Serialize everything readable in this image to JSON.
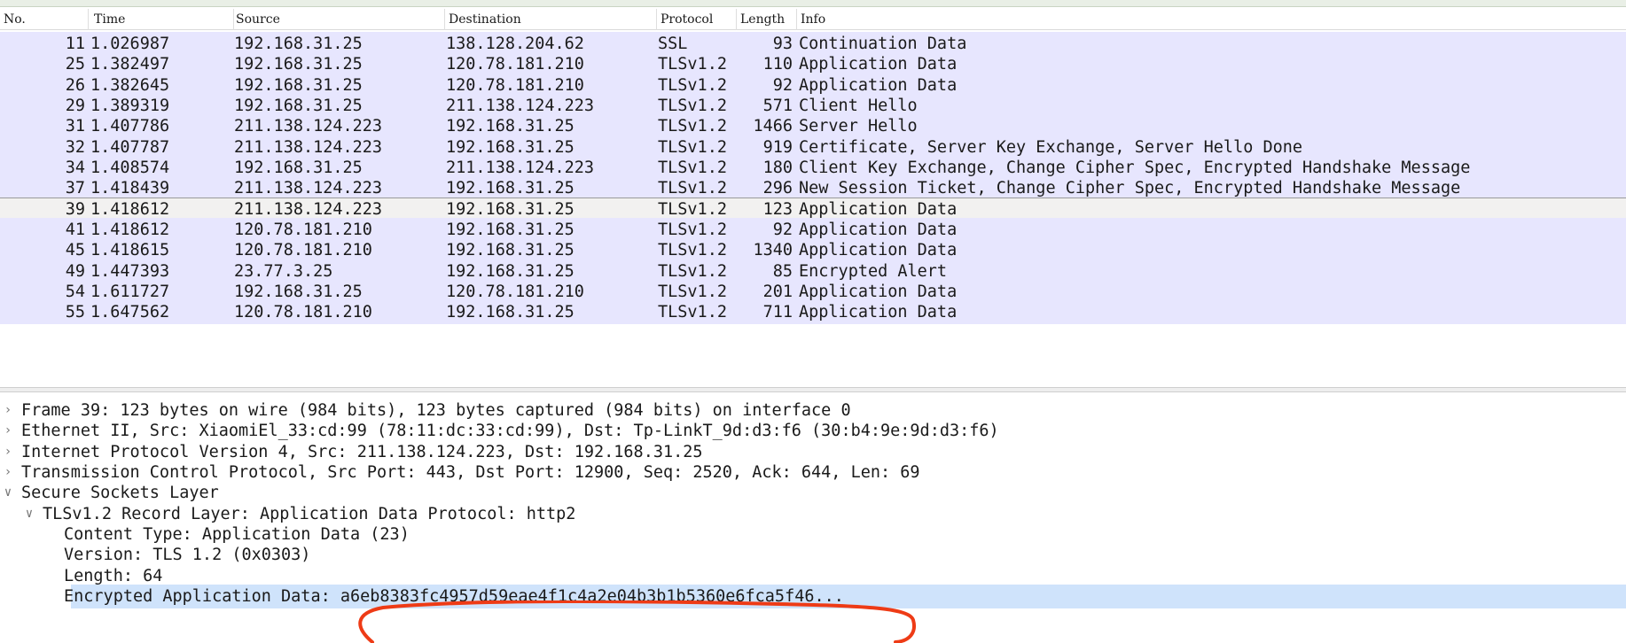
{
  "columns": {
    "no": "No.",
    "time": "Time",
    "source": "Source",
    "destination": "Destination",
    "protocol": "Protocol",
    "length": "Length",
    "info": "Info"
  },
  "packets": [
    {
      "no": "11",
      "time": "1.026987",
      "source": "192.168.31.25",
      "destination": "138.128.204.62",
      "protocol": "SSL",
      "length": "93",
      "info": "Continuation Data"
    },
    {
      "no": "25",
      "time": "1.382497",
      "source": "192.168.31.25",
      "destination": "120.78.181.210",
      "protocol": "TLSv1.2",
      "length": "110",
      "info": "Application Data"
    },
    {
      "no": "26",
      "time": "1.382645",
      "source": "192.168.31.25",
      "destination": "120.78.181.210",
      "protocol": "TLSv1.2",
      "length": "92",
      "info": "Application Data"
    },
    {
      "no": "29",
      "time": "1.389319",
      "source": "192.168.31.25",
      "destination": "211.138.124.223",
      "protocol": "TLSv1.2",
      "length": "571",
      "info": "Client Hello"
    },
    {
      "no": "31",
      "time": "1.407786",
      "source": "211.138.124.223",
      "destination": "192.168.31.25",
      "protocol": "TLSv1.2",
      "length": "1466",
      "info": "Server Hello"
    },
    {
      "no": "32",
      "time": "1.407787",
      "source": "211.138.124.223",
      "destination": "192.168.31.25",
      "protocol": "TLSv1.2",
      "length": "919",
      "info": "Certificate, Server Key Exchange, Server Hello Done"
    },
    {
      "no": "34",
      "time": "1.408574",
      "source": "192.168.31.25",
      "destination": "211.138.124.223",
      "protocol": "TLSv1.2",
      "length": "180",
      "info": "Client Key Exchange, Change Cipher Spec, Encrypted Handshake Message"
    },
    {
      "no": "37",
      "time": "1.418439",
      "source": "211.138.124.223",
      "destination": "192.168.31.25",
      "protocol": "TLSv1.2",
      "length": "296",
      "info": "New Session Ticket, Change Cipher Spec, Encrypted Handshake Message"
    },
    {
      "no": "39",
      "time": "1.418612",
      "source": "211.138.124.223",
      "destination": "192.168.31.25",
      "protocol": "TLSv1.2",
      "length": "123",
      "info": "Application Data",
      "selected": true
    },
    {
      "no": "41",
      "time": "1.418612",
      "source": "120.78.181.210",
      "destination": "192.168.31.25",
      "protocol": "TLSv1.2",
      "length": "92",
      "info": "Application Data"
    },
    {
      "no": "45",
      "time": "1.418615",
      "source": "120.78.181.210",
      "destination": "192.168.31.25",
      "protocol": "TLSv1.2",
      "length": "1340",
      "info": "Application Data"
    },
    {
      "no": "49",
      "time": "1.447393",
      "source": "23.77.3.25",
      "destination": "192.168.31.25",
      "protocol": "TLSv1.2",
      "length": "85",
      "info": "Encrypted Alert"
    },
    {
      "no": "54",
      "time": "1.611727",
      "source": "192.168.31.25",
      "destination": "120.78.181.210",
      "protocol": "TLSv1.2",
      "length": "201",
      "info": "Application Data"
    },
    {
      "no": "55",
      "time": "1.647562",
      "source": "120.78.181.210",
      "destination": "192.168.31.25",
      "protocol": "TLSv1.2",
      "length": "711",
      "info": "Application Data"
    }
  ],
  "details": [
    {
      "text": "Frame 39: 123 bytes on wire (984 bits), 123 bytes captured (984 bits) on interface 0",
      "level": 0,
      "arrow": "collapsed"
    },
    {
      "text": "Ethernet II, Src: XiaomiEl_33:cd:99 (78:11:dc:33:cd:99), Dst: Tp-LinkT_9d:d3:f6 (30:b4:9e:9d:d3:f6)",
      "level": 0,
      "arrow": "collapsed"
    },
    {
      "text": "Internet Protocol Version 4, Src: 211.138.124.223, Dst: 192.168.31.25",
      "level": 0,
      "arrow": "collapsed"
    },
    {
      "text": "Transmission Control Protocol, Src Port: 443, Dst Port: 12900, Seq: 2520, Ack: 644, Len: 69",
      "level": 0,
      "arrow": "collapsed"
    },
    {
      "text": "Secure Sockets Layer",
      "level": 0,
      "arrow": "expanded"
    },
    {
      "text": "TLSv1.2 Record Layer: Application Data Protocol: http2",
      "level": 1,
      "arrow": "expanded"
    },
    {
      "text": "Content Type: Application Data (23)",
      "level": 2,
      "arrow": "none"
    },
    {
      "text": "Version: TLS 1.2 (0x0303)",
      "level": 2,
      "arrow": "none"
    },
    {
      "text": "Length: 64",
      "level": 2,
      "arrow": "none"
    },
    {
      "text": "Encrypted Application Data: a6eb8383fc4957d59eae4f1c4a2e04b3b1b5360e6fca5f46...",
      "level": 2,
      "arrow": "none",
      "highlighted": true
    }
  ],
  "icons": {
    "collapsed": "chevron-right-icon",
    "expanded": "chevron-down-icon"
  },
  "colors": {
    "row_bg": "#e7e6fe",
    "selected_row_bg": "#f2f1f0",
    "detail_highlight": "#cfe3fb",
    "annotation": "#ee3b16"
  }
}
